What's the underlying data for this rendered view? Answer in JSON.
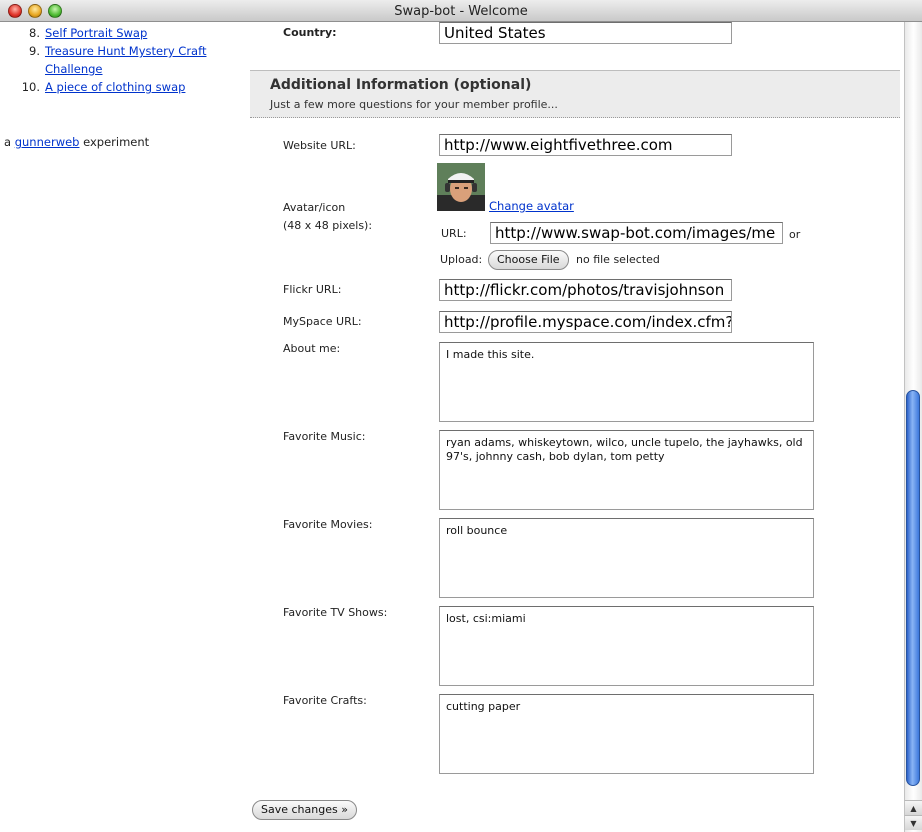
{
  "window": {
    "title": "Swap-bot - Welcome"
  },
  "sidebar": {
    "items": [
      {
        "num": "8.",
        "label": "Self Portrait Swap"
      },
      {
        "num": "9.",
        "label": "Treasure Hunt Mystery Craft Challenge"
      },
      {
        "num": "10.",
        "label": "A piece of clothing swap"
      }
    ],
    "credit_prefix": "a",
    "credit_link": "gunnerweb",
    "credit_suffix": "experiment"
  },
  "form": {
    "country_label": "Country:",
    "country_value": "United States",
    "section_title": "Additional Information (optional)",
    "section_subtitle": "Just a few more questions for your member profile...",
    "website_label": "Website URL:",
    "website_value": "http://www.eightfivethree.com",
    "avatar_label_1": "Avatar/icon",
    "avatar_label_2": "(48 x 48 pixels):",
    "change_avatar": "Change avatar",
    "url_label": "URL:",
    "avatar_url_value": "http://www.swap-bot.com/images/me",
    "or_text": "or",
    "upload_label": "Upload:",
    "choose_file": "Choose File",
    "no_file": "no file selected",
    "flickr_label": "Flickr URL:",
    "flickr_value": "http://flickr.com/photos/travisjohnson",
    "myspace_label": "MySpace URL:",
    "myspace_value": "http://profile.myspace.com/index.cfm?",
    "about_label": "About me:",
    "about_value": "I made this site.",
    "music_label": "Favorite Music:",
    "music_value": "ryan adams, whiskeytown, wilco, uncle tupelo, the jayhawks, old 97's, johnny cash, bob dylan, tom petty",
    "movies_label": "Favorite Movies:",
    "movies_value": "roll bounce",
    "tv_label": "Favorite TV Shows:",
    "tv_value": "lost, csi:miami",
    "crafts_label": "Favorite Crafts:",
    "crafts_value": "cutting paper",
    "save_button": "Save changes »"
  }
}
